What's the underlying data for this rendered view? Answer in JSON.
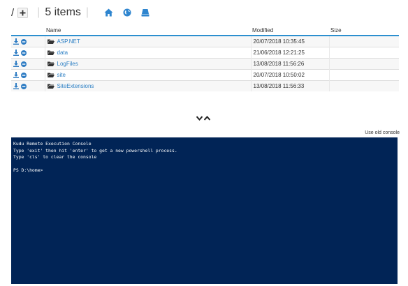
{
  "toolbar": {
    "root": "/",
    "item_count": "5 items",
    "icons": [
      "plus-icon",
      "home-icon",
      "globe-icon",
      "drive-icon"
    ]
  },
  "table": {
    "headers": {
      "actions": "",
      "name": "Name",
      "modified": "Modified",
      "size": "Size"
    },
    "rows": [
      {
        "name": "ASP.NET",
        "modified": "20/07/2018 10:35:45",
        "size": ""
      },
      {
        "name": "data",
        "modified": "21/06/2018 12:21:25",
        "size": ""
      },
      {
        "name": "LogFiles",
        "modified": "13/08/2018 11:56:26",
        "size": ""
      },
      {
        "name": "site",
        "modified": "20/07/2018 10:50:02",
        "size": ""
      },
      {
        "name": "SiteExtensions",
        "modified": "13/08/2018 11:56:33",
        "size": ""
      }
    ]
  },
  "toggle": {
    "icons": [
      "chevron-down-icon",
      "chevron-up-icon"
    ]
  },
  "use_old_console": "Use old console",
  "console": {
    "lines": [
      "Kudu Remote Execution Console",
      "Type 'exit' then hit 'enter' to get a new powershell process.",
      "Type 'cls' to clear the console",
      "",
      "PS D:\\home>"
    ]
  },
  "colors": {
    "accent": "#2c8fcf",
    "link": "#2c7fc4",
    "console_bg": "#012456",
    "download_icon": "#2e7cc3",
    "remove_icon": "#2e7cc3"
  }
}
